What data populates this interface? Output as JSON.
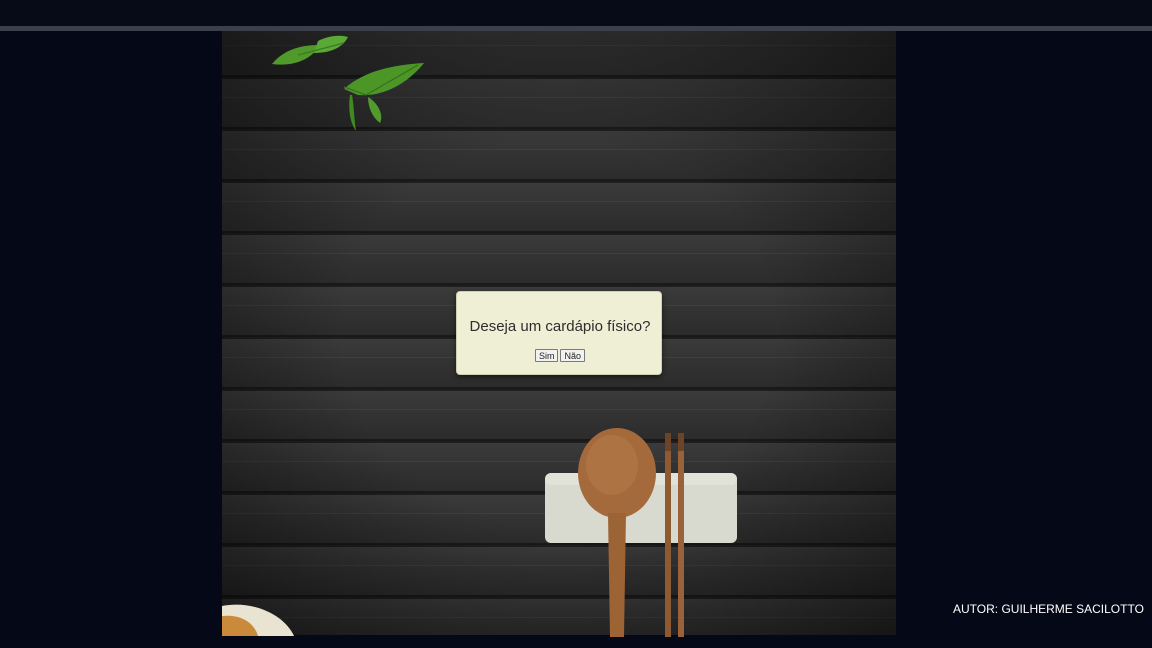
{
  "dialog": {
    "question": "Deseja um cardápio físico?",
    "yes_label": "Sim",
    "no_label": "Não"
  },
  "footer": {
    "author": "AUTOR: GUILHERME SACILOTTO"
  },
  "icons": {
    "leaves": "tea-leaves-icon",
    "spoon": "wooden-spoon-icon",
    "chopsticks": "chopsticks-icon",
    "rest": "chopstick-rest-icon",
    "plate": "bowl-icon"
  },
  "colors": {
    "background": "#070b18",
    "dialog": "#efefd6",
    "wood": "#333333",
    "author_text": "#ffffff"
  }
}
